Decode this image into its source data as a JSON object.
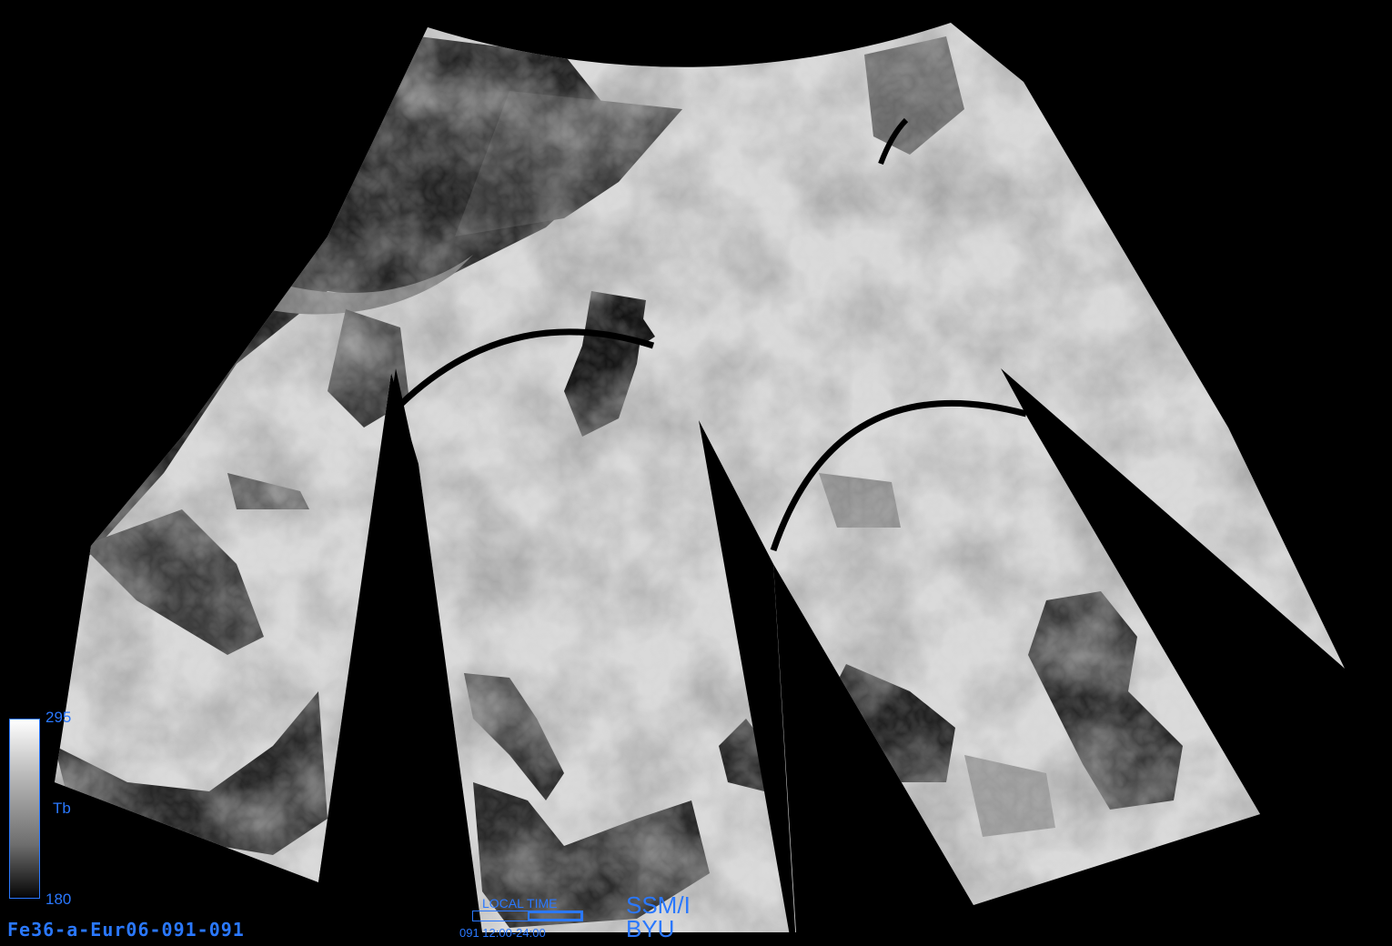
{
  "image_id": "Fe36-a-Eur06-091-091",
  "colorbar": {
    "label": "Tb",
    "max": "295",
    "min": "180",
    "colors": [
      "#ffffff",
      "#000000"
    ]
  },
  "local_time": {
    "title": "LOCAL TIME",
    "day": "091",
    "range": "12:00-24:00",
    "range_text": "091  12:00-24:00",
    "coverage_fraction": 0.5
  },
  "sensor": "SSM/I",
  "organization": "BYU",
  "accent_color": "#2a78ff",
  "background_color": "#000000",
  "icons": [
    "colorbar",
    "swath-image"
  ]
}
